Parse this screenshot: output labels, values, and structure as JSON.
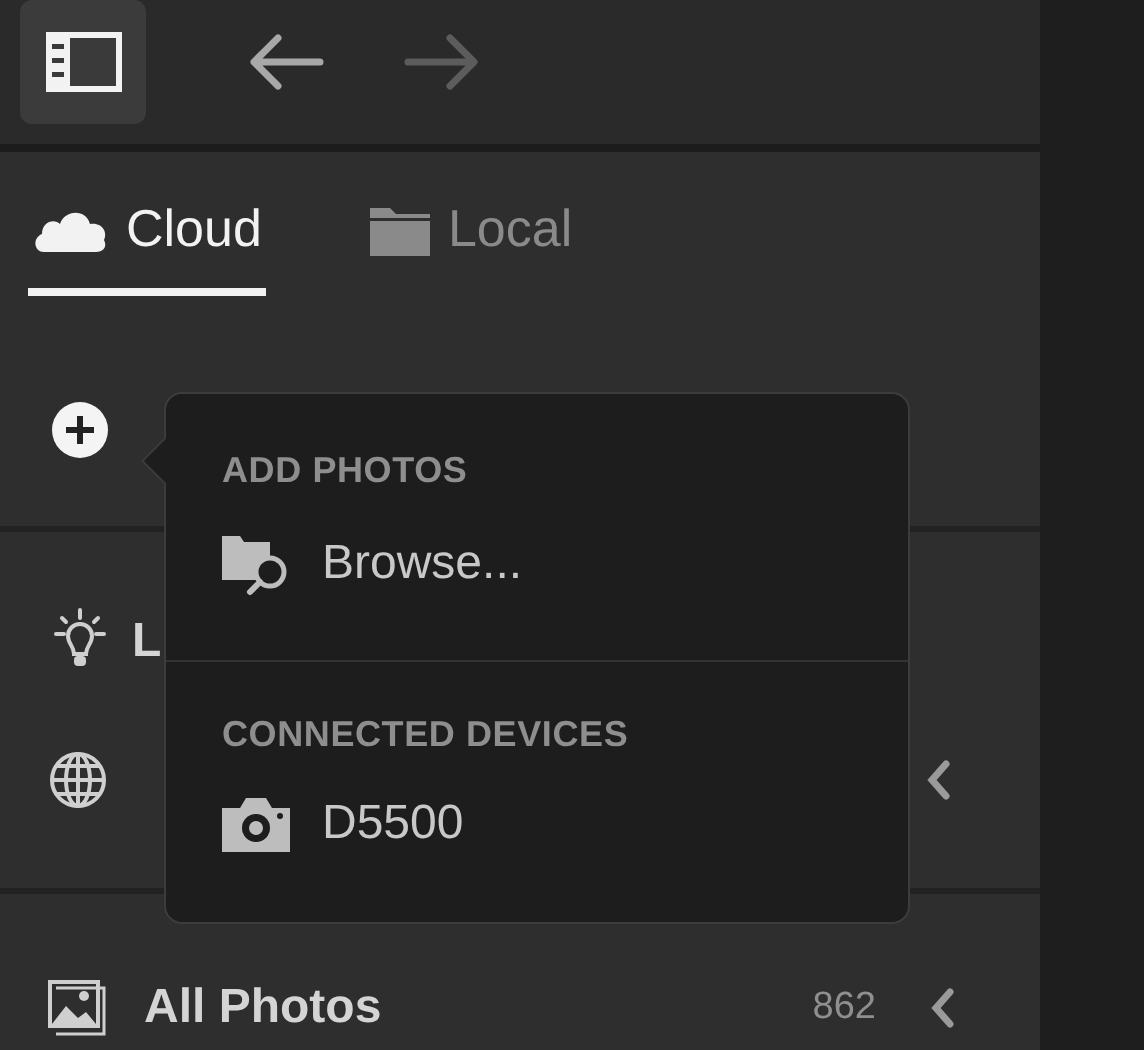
{
  "toolbar": {
    "nav": [
      {
        "kind": "back",
        "disabled": false
      },
      {
        "kind": "forward",
        "disabled": true
      }
    ]
  },
  "tabs": [
    {
      "label": "Cloud",
      "kind": "cloud",
      "selected": true
    },
    {
      "label": "Local",
      "kind": "folder",
      "selected": false
    }
  ],
  "sidebar_items": [
    {
      "kind": "learn",
      "label": "L"
    },
    {
      "kind": "community"
    },
    {
      "kind": "all-photos",
      "label": "All Photos",
      "count": "862"
    }
  ],
  "popover": {
    "sections": [
      {
        "heading": "ADD PHOTOS",
        "items": [
          {
            "kind": "browse",
            "label": "Browse..."
          }
        ]
      },
      {
        "heading": "CONNECTED DEVICES",
        "items": [
          {
            "kind": "camera",
            "label": "D5500"
          }
        ]
      }
    ]
  }
}
